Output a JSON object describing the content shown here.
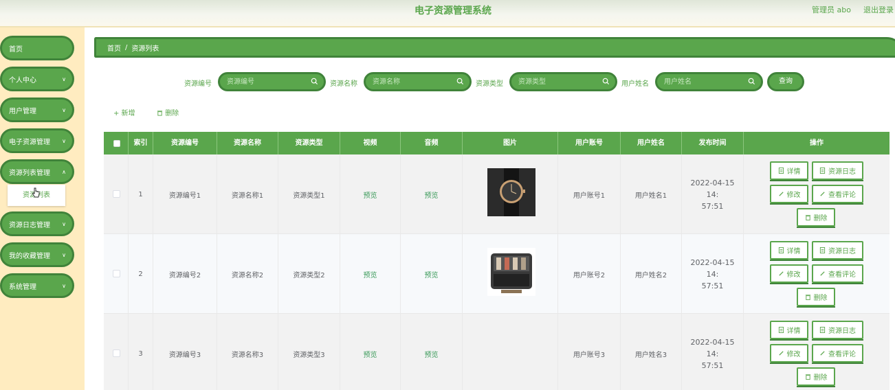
{
  "header": {
    "title": "电子资源管理系统",
    "admin": "管理员 abo",
    "logout": "退出登录"
  },
  "sidebar": {
    "items": [
      {
        "label": "首页",
        "has_chevron": false
      },
      {
        "label": "个人中心",
        "has_chevron": true
      },
      {
        "label": "用户管理",
        "has_chevron": true
      },
      {
        "label": "电子资源管理",
        "has_chevron": true
      },
      {
        "label": "资源列表管理",
        "has_chevron": true
      },
      {
        "label": "资源日志管理",
        "has_chevron": true
      },
      {
        "label": "我的收藏管理",
        "has_chevron": true
      },
      {
        "label": "系统管理",
        "has_chevron": true
      }
    ],
    "submenu": {
      "label": "资源列表"
    }
  },
  "breadcrumb": {
    "home": "首页",
    "separator": "/",
    "current": "资源列表"
  },
  "search": {
    "fields": [
      {
        "label": "资源编号",
        "placeholder": "资源编号"
      },
      {
        "label": "资源名称",
        "placeholder": "资源名称"
      },
      {
        "label": "资源类型",
        "placeholder": "资源类型"
      },
      {
        "label": "用户姓名",
        "placeholder": "用户姓名"
      }
    ],
    "query_button": "查询"
  },
  "actions": {
    "add": "+ 新增",
    "delete": "删除"
  },
  "table": {
    "headers": [
      "索引",
      "资源编号",
      "资源名称",
      "资源类型",
      "视频",
      "音频",
      "图片",
      "用户账号",
      "用户姓名",
      "发布时间",
      "操作"
    ],
    "rows": [
      {
        "index": "1",
        "code": "资源编号1",
        "name": "资源名称1",
        "type": "资源类型1",
        "video": "预览",
        "audio": "预览",
        "image": "watch-black-gold",
        "account": "用户账号1",
        "username": "用户姓名1",
        "time_line1": "2022-04-15 14:",
        "time_line2": "57:51"
      },
      {
        "index": "2",
        "code": "资源编号2",
        "name": "资源名称2",
        "type": "资源类型2",
        "video": "预览",
        "audio": "预览",
        "image": "watch-box-collection",
        "account": "用户账号2",
        "username": "用户姓名2",
        "time_line1": "2022-04-15 14:",
        "time_line2": "57:51"
      },
      {
        "index": "3",
        "code": "资源编号3",
        "name": "资源名称3",
        "type": "资源类型3",
        "video": "预览",
        "audio": "预览",
        "image": "",
        "account": "用户账号3",
        "username": "用户姓名3",
        "time_line1": "2022-04-15 14:",
        "time_line2": "57:51"
      }
    ],
    "ops": {
      "detail": "详情",
      "log": "资源日志",
      "edit": "修改",
      "review": "查看评论",
      "delete": "删除"
    }
  },
  "colors": {
    "primary": "#5aa64c",
    "border": "#40833a",
    "sidebar_bg": "#ffecc0",
    "link": "#3a9a59"
  }
}
